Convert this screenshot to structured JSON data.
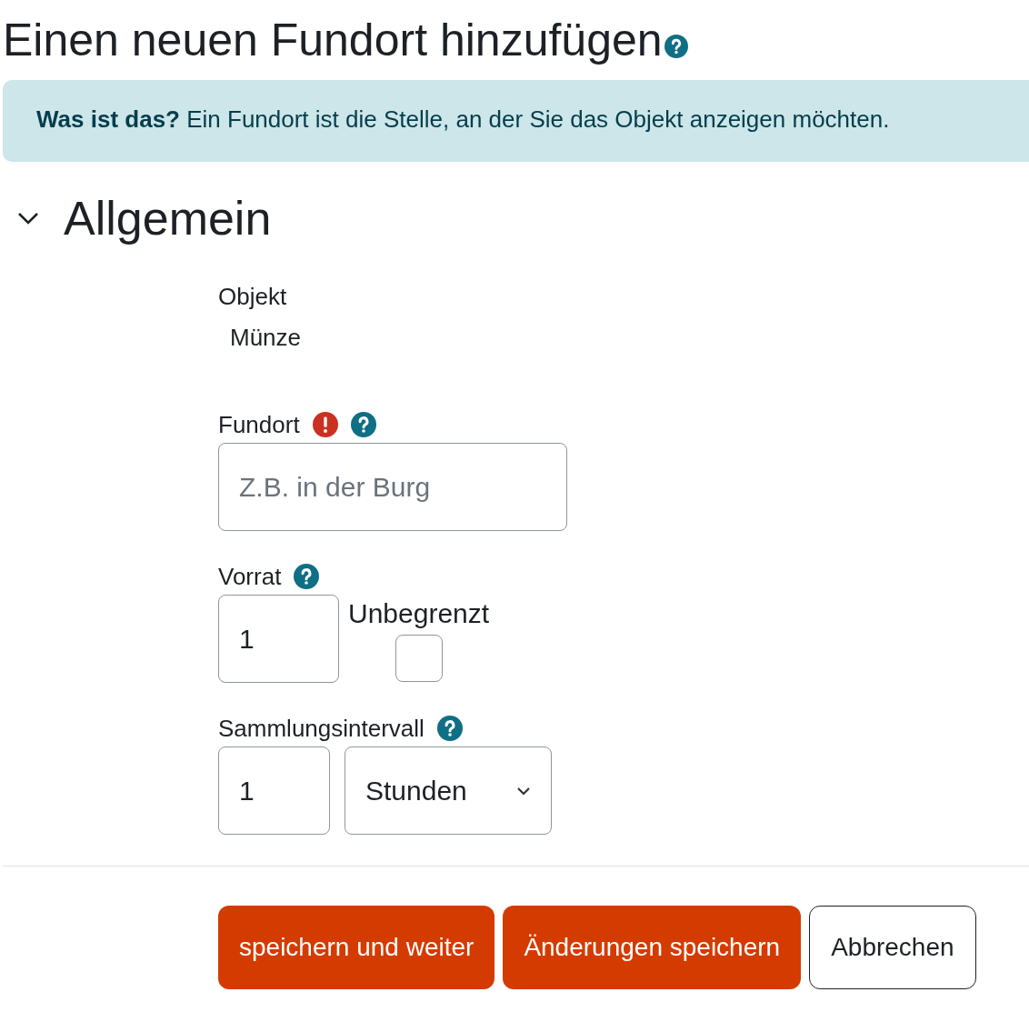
{
  "title": "Einen neuen Fundort hinzufügen",
  "title_help": true,
  "info": "**Was ist das?** Ein Fundort ist die Stelle, an der Sie das Objekt anzeigen möchten.",
  "section": {
    "title": "Allgemein",
    "expanded": true
  },
  "fields": [
    {
      "kind": "static",
      "label": "Objekt",
      "value": "Münze",
      "required": false,
      "help": false
    },
    {
      "kind": "text",
      "label": "Fundort",
      "placeholder": "Z.B. in der Burg",
      "required": true,
      "help": true
    },
    {
      "kind": "number_checkbox",
      "label": "Vorrat",
      "value": "1",
      "checkbox_label": "Unbegrenzt",
      "checked": false,
      "required": false,
      "help": true
    },
    {
      "kind": "interval",
      "label": "Sammlungsintervall",
      "value": "1",
      "unit": "Stunden",
      "required": false,
      "help": true
    }
  ],
  "buttons": [
    {
      "label": "speichern und weiter",
      "kind": "primary"
    },
    {
      "label": "Änderungen speichern",
      "kind": "primary"
    },
    {
      "label": "Abbrechen",
      "kind": "secondary"
    }
  ]
}
